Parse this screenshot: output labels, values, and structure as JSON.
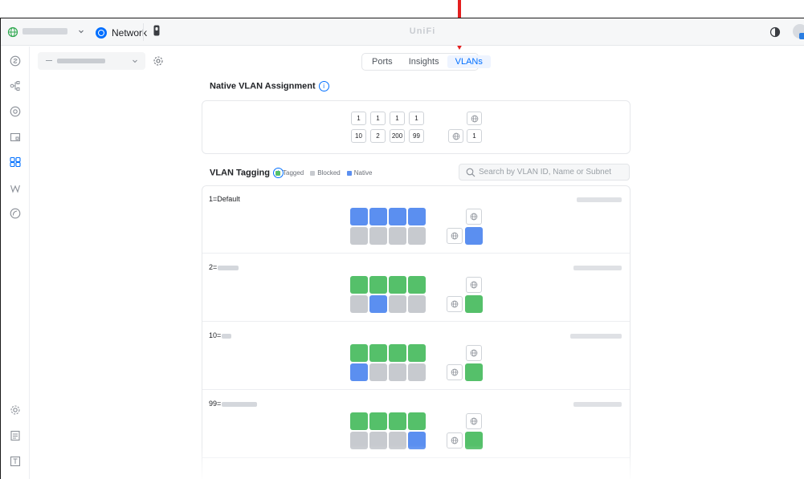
{
  "topbar": {
    "app_label": "Network",
    "title": "UniFi"
  },
  "tabs": [
    {
      "label": "Ports",
      "active": false
    },
    {
      "label": "Insights",
      "active": false
    },
    {
      "label": "VLANs",
      "active": true
    }
  ],
  "native_vlan": {
    "title": "Native VLAN Assignment",
    "info_glyph": "i",
    "top_row": [
      "1",
      "1",
      "1",
      "1"
    ],
    "bottom_row": [
      "10",
      "2",
      "200",
      "99"
    ],
    "uplink_value": "1"
  },
  "vlan_tagging": {
    "title": "VLAN Tagging",
    "info_glyph": "i",
    "legend": [
      {
        "label": "Tagged",
        "color": "#55c06a"
      },
      {
        "label": "Blocked",
        "color": "#c7cacf"
      },
      {
        "label": "Native",
        "color": "#5b8ff0"
      }
    ],
    "search_placeholder": "Search by VLAN ID, Name or Subnet",
    "rows": [
      {
        "label": "1=Default",
        "top": [
          "native",
          "native",
          "native",
          "native"
        ],
        "bottom": [
          "blocked",
          "blocked",
          "blocked",
          "blocked"
        ],
        "uplink": "native"
      },
      {
        "label": "2=",
        "top": [
          "tagged",
          "tagged",
          "tagged",
          "tagged"
        ],
        "bottom": [
          "blocked",
          "native",
          "blocked",
          "blocked"
        ],
        "uplink": "tagged"
      },
      {
        "label": "10=",
        "top": [
          "tagged",
          "tagged",
          "tagged",
          "tagged"
        ],
        "bottom": [
          "native",
          "blocked",
          "blocked",
          "blocked"
        ],
        "uplink": "tagged"
      },
      {
        "label": "99=",
        "top": [
          "tagged",
          "tagged",
          "tagged",
          "tagged"
        ],
        "bottom": [
          "blocked",
          "blocked",
          "blocked",
          "native"
        ],
        "uplink": "tagged"
      }
    ]
  },
  "colors": {
    "accent": "#006fff",
    "tagged": "#55c06a",
    "blocked": "#c7cacf",
    "native": "#5b8ff0",
    "arrow": "#e41e1e"
  }
}
